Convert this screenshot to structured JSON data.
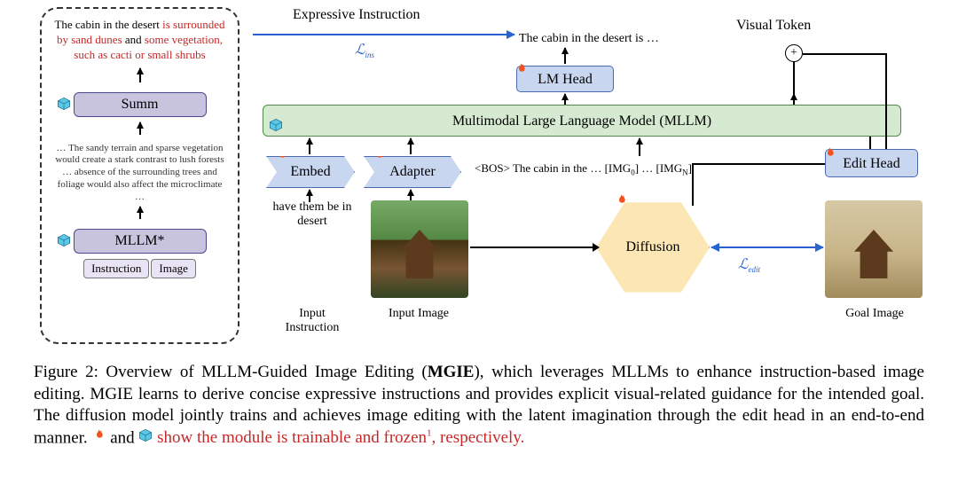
{
  "left_panel": {
    "instruction_black_1": "The cabin in the desert ",
    "instruction_red_1": "is surrounded by sand dunes",
    "instruction_black_2": " and ",
    "instruction_red_2": "some vegetation, such as cacti or small shrubs",
    "summ_label": "Summ",
    "detail": "… The sandy terrain and sparse vegetation would create a stark contrast to lush forests … absence of the surrounding trees and foliage would also affect the microclimate …",
    "mllm_star": "MLLM*",
    "input_left": "Instruction",
    "input_right": "Image"
  },
  "top": {
    "expressive": "Expressive Instruction",
    "l_ins": "ℒ",
    "l_ins_sub": "ins",
    "cabin_output": "The cabin in the desert is …",
    "visual_token": "Visual Token"
  },
  "blocks": {
    "lm_head": "LM Head",
    "mllm_bar": "Multimodal Large Language Model (MLLM)",
    "embed": "Embed",
    "adapter": "Adapter",
    "edit_head": "Edit Head",
    "diffusion": "Diffusion",
    "token_sequence_pre": "<BOS> The cabin in the …  [IMG",
    "token_sequence_mid": "] … [IMG",
    "token_sequence_post": "]"
  },
  "labels": {
    "have_them": "have them be in desert",
    "input_instruction": "Input Instruction",
    "input_image": "Input Image",
    "goal_image": "Goal Image",
    "l_edit": "ℒ",
    "l_edit_sub": "edit"
  },
  "caption": {
    "prefix": "Figure 2: Overview of MLLM-Guided Image Editing (",
    "bold": "MGIE",
    "mid": "), which leverages MLLMs to enhance instruction-based image editing. MGIE learns to derive concise expressive instructions and provides explicit visual-related guidance for the intended goal. The diffusion model jointly trains and achieves image editing with the latent imagination through the edit head in an end-to-end manner. ",
    "red_part": " show the module is trainable and frozen",
    "red_tail": ", respectively.",
    "and": " and "
  },
  "icons": {
    "fire": "fire-icon",
    "frozen": "cube-frozen-icon",
    "plus": "+"
  }
}
